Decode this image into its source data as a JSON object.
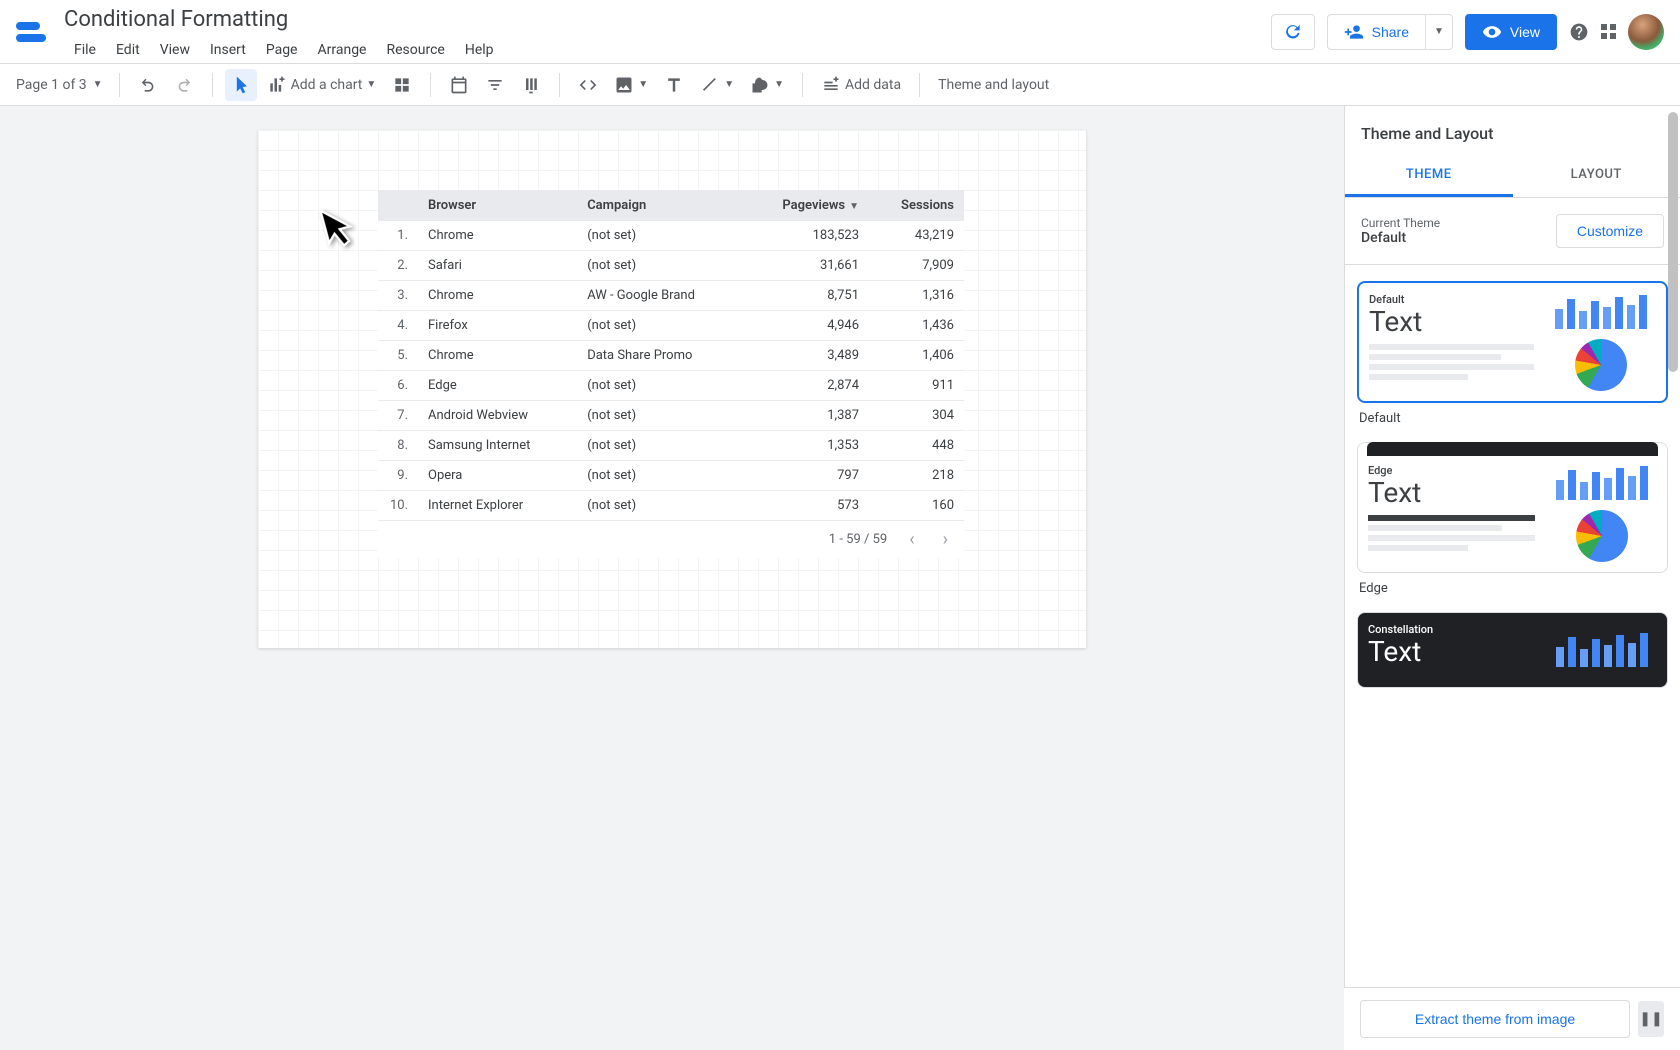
{
  "doc_title": "Conditional Formatting",
  "menu": {
    "file": "File",
    "edit": "Edit",
    "view": "View",
    "insert": "Insert",
    "page": "Page",
    "arrange": "Arrange",
    "resource": "Resource",
    "help": "Help"
  },
  "header_buttons": {
    "share": "Share",
    "view": "View"
  },
  "toolbar": {
    "page_indicator": "Page 1 of 3",
    "add_chart": "Add a chart",
    "add_data": "Add data",
    "theme_layout": "Theme and layout"
  },
  "table": {
    "headers": {
      "browser": "Browser",
      "campaign": "Campaign",
      "pageviews": "Pageviews",
      "sessions": "Sessions"
    },
    "rows": [
      {
        "n": "1.",
        "browser": "Chrome",
        "campaign": "(not set)",
        "pageviews": "183,523",
        "sessions": "43,219"
      },
      {
        "n": "2.",
        "browser": "Safari",
        "campaign": "(not set)",
        "pageviews": "31,661",
        "sessions": "7,909"
      },
      {
        "n": "3.",
        "browser": "Chrome",
        "campaign": "AW - Google Brand",
        "pageviews": "8,751",
        "sessions": "1,316"
      },
      {
        "n": "4.",
        "browser": "Firefox",
        "campaign": "(not set)",
        "pageviews": "4,946",
        "sessions": "1,436"
      },
      {
        "n": "5.",
        "browser": "Chrome",
        "campaign": "Data Share Promo",
        "pageviews": "3,489",
        "sessions": "1,406"
      },
      {
        "n": "6.",
        "browser": "Edge",
        "campaign": "(not set)",
        "pageviews": "2,874",
        "sessions": "911"
      },
      {
        "n": "7.",
        "browser": "Android Webview",
        "campaign": "(not set)",
        "pageviews": "1,387",
        "sessions": "304"
      },
      {
        "n": "8.",
        "browser": "Samsung Internet",
        "campaign": "(not set)",
        "pageviews": "1,353",
        "sessions": "448"
      },
      {
        "n": "9.",
        "browser": "Opera",
        "campaign": "(not set)",
        "pageviews": "797",
        "sessions": "218"
      },
      {
        "n": "10.",
        "browser": "Internet Explorer",
        "campaign": "(not set)",
        "pageviews": "573",
        "sessions": "160"
      }
    ],
    "footer_range": "1 - 59 / 59"
  },
  "sidepanel": {
    "title": "Theme and Layout",
    "tab_theme": "THEME",
    "tab_layout": "LAYOUT",
    "current_label": "Current Theme",
    "current_name": "Default",
    "customize": "Customize",
    "themes": {
      "default": {
        "name": "Default",
        "text": "Text"
      },
      "edge": {
        "name": "Edge",
        "text": "Text"
      },
      "constellation": {
        "name": "Constellation",
        "text": "Text"
      }
    },
    "extract": "Extract theme from image"
  }
}
